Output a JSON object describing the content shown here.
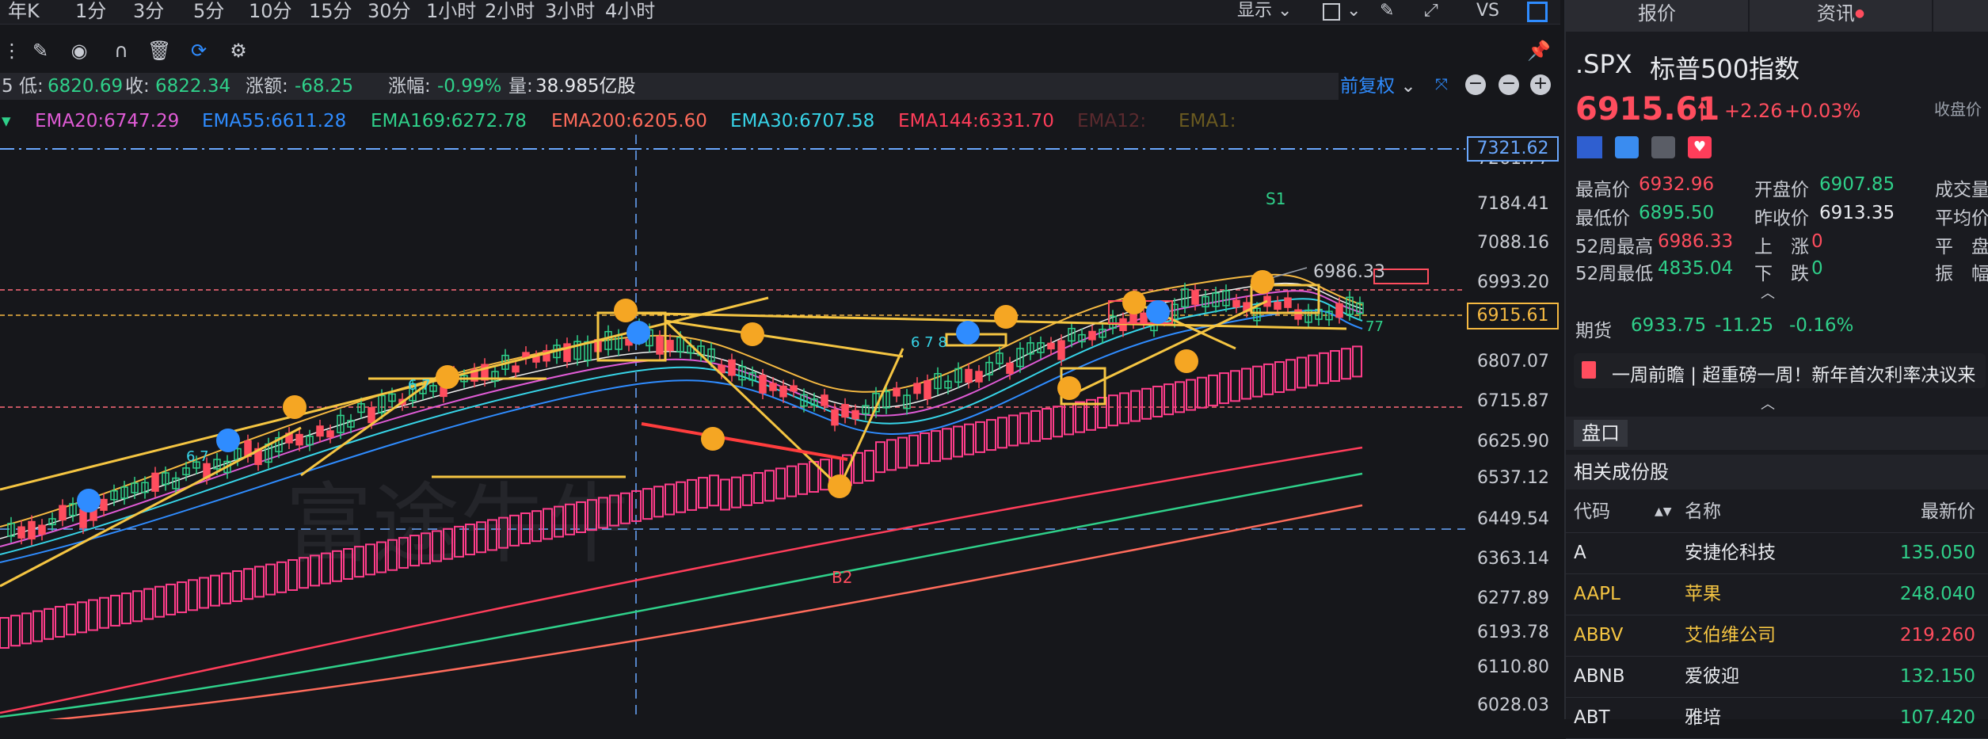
{
  "timeframes": [
    "年K",
    "1分",
    "3分",
    "5分",
    "10分",
    "15分",
    "30分",
    "1小时",
    "2小时",
    "3小时",
    "4小时"
  ],
  "topbar_right": {
    "display": "显示",
    "vs": "VS"
  },
  "infobar": {
    "low_label": "5 低:",
    "low": "6820.69",
    "close_label": "收:",
    "close": "6822.34",
    "change_label": "涨额:",
    "change": "-68.25",
    "pct_label": "涨幅:",
    "pct": "-0.99%",
    "vol_label": "量:",
    "vol": "38.985亿股",
    "adjust": "前复权"
  },
  "ema_legend": [
    {
      "label": "EMA20:6747.29",
      "color": "#e05bd6"
    },
    {
      "label": "EMA55:6611.28",
      "color": "#2f8cff"
    },
    {
      "label": "EMA169:6272.78",
      "color": "#2fd08a"
    },
    {
      "label": "EMA200:6205.60",
      "color": "#ff6b5b"
    },
    {
      "label": "EMA30:6707.58",
      "color": "#37d4e8"
    },
    {
      "label": "EMA144:6331.70",
      "color": "#ff3d5a"
    },
    {
      "label": "EMA12:",
      "color": "#5a2a2e"
    },
    {
      "label": "EMA1:",
      "color": "#6a5a20"
    }
  ],
  "axis": {
    "labels": [
      "7261.77",
      "7184.41",
      "7088.16",
      "6993.20",
      "6807.07",
      "6715.87",
      "6625.90",
      "6537.12",
      "6449.54",
      "6363.14",
      "6277.89",
      "6193.78",
      "6110.80",
      "6028.03"
    ],
    "box_high": "7321.62",
    "box_price": "6915.61"
  },
  "annotations": {
    "s1": "S1",
    "b2": "B2",
    "peak": "6986.33",
    "tail": "77"
  },
  "quote": {
    "symbol": ".SPX",
    "name": "标普500指数",
    "price": "6915.61",
    "change": "+2.26",
    "pct": "+0.03%",
    "prev_close_label": "收盘价",
    "high_label": "最高价",
    "high": "6932.96",
    "low_label": "最低价",
    "low": "6895.50",
    "w52h_label": "52周最高",
    "w52h": "6986.33",
    "w52l_label": "52周最低",
    "w52l": "4835.04",
    "open_label": "开盘价",
    "open": "6907.85",
    "prev_label": "昨收价",
    "prev": "6913.35",
    "up_label": "上　涨",
    "up": "0",
    "down_label": "下　跌",
    "down": "0",
    "vol_label": "成交量",
    "avg_label": "平均价",
    "flat_label": "平　盘",
    "amp_label": "振　幅",
    "futures_label": "期货",
    "futures": "6933.75",
    "futures_chg": "-11.25",
    "futures_pct": "-0.16%",
    "news": "一周前瞻 | 超重磅一周！新年首次利率决议来"
  },
  "tabs": {
    "quote": "报价",
    "news": "资讯"
  },
  "pankou": "盘口",
  "components": {
    "title": "相关成份股",
    "headers": {
      "code": "代码",
      "name": "名称",
      "price": "最新价"
    },
    "rows": [
      {
        "code": "A",
        "name": "安捷伦科技",
        "price": "135.050",
        "color": "#2fd08a"
      },
      {
        "code": "AAPL",
        "name": "苹果",
        "price": "248.040",
        "color": "#2fd08a"
      },
      {
        "code": "ABBV",
        "name": "艾伯维公司",
        "price": "219.260",
        "color": "#ff4d5e"
      },
      {
        "code": "ABNB",
        "name": "爱彼迎",
        "price": "132.150",
        "color": "#2fd08a"
      },
      {
        "code": "ABT",
        "name": "雅培",
        "price": "107.420",
        "color": "#2fd08a"
      }
    ]
  },
  "colors": {
    "up": "#ff4d5e",
    "down": "#2fd08a",
    "accent": "#2f8cff"
  }
}
